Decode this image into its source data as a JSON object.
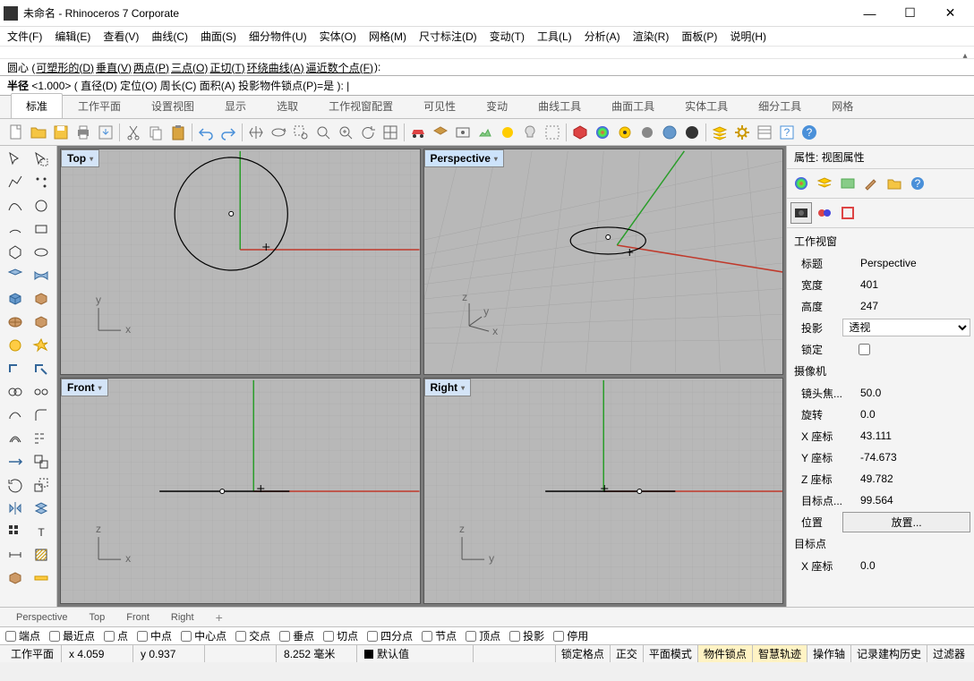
{
  "window": {
    "title": "未命名 - Rhinoceros 7 Corporate"
  },
  "menubar": [
    "文件(F)",
    "编辑(E)",
    "查看(V)",
    "曲线(C)",
    "曲面(S)",
    "细分物件(U)",
    "实体(O)",
    "网格(M)",
    "尺寸标注(D)",
    "变动(T)",
    "工具(L)",
    "分析(A)",
    "渲染(R)",
    "面板(P)",
    "说明(H)"
  ],
  "cmd": {
    "history_hint": "",
    "line1_prefix": "圆心 ( ",
    "line1_opts": [
      "可塑形的(D)",
      "垂直(V)",
      "两点(P)",
      "三点(O)",
      "正切(T)",
      "环绕曲线(A)",
      "逼近数个点(F)"
    ],
    "line2_label": "半径",
    "line2_val": "<1.000>",
    "line2_prefix": " ( ",
    "line2_opts": [
      "直径(D)",
      "定位(O)",
      "周长(C)",
      "面积(A)"
    ],
    "line2_kv": "投影物件锁点(P)=是",
    "suffix": " ):",
    "cursor": "|"
  },
  "tabs": [
    "标准",
    "工作平面",
    "设置视图",
    "显示",
    "选取",
    "工作视窗配置",
    "可见性",
    "变动",
    "曲线工具",
    "曲面工具",
    "实体工具",
    "细分工具",
    "网格"
  ],
  "active_tab": 0,
  "viewports": {
    "tl": {
      "label": "Top"
    },
    "tr": {
      "label": "Perspective"
    },
    "bl": {
      "label": "Front"
    },
    "br": {
      "label": "Right"
    }
  },
  "vptabs": [
    "Perspective",
    "Top",
    "Front",
    "Right"
  ],
  "properties": {
    "header": "属性: 视图属性",
    "sec_viewport": "工作视窗",
    "title_lbl": "标题",
    "title_val": "Perspective",
    "width_lbl": "宽度",
    "width_val": "401",
    "height_lbl": "高度",
    "height_val": "247",
    "proj_lbl": "投影",
    "proj_val": "透视",
    "lock_lbl": "锁定",
    "sec_camera": "摄像机",
    "lens_lbl": "镜头焦...",
    "lens_val": "50.0",
    "rot_lbl": "旋转",
    "rot_val": "0.0",
    "x_lbl": "X 座标",
    "x_val": "43.111",
    "y_lbl": "Y 座标",
    "y_val": "-74.673",
    "z_lbl": "Z 座标",
    "z_val": "49.782",
    "tgtdist_lbl": "目标点...",
    "tgtdist_val": "99.564",
    "pos_lbl": "位置",
    "pos_btn": "放置...",
    "sec_target": "目标点",
    "tx_lbl": "X 座标",
    "tx_val": "0.0"
  },
  "osnap": [
    "端点",
    "最近点",
    "点",
    "中点",
    "中心点",
    "交点",
    "垂点",
    "切点",
    "四分点",
    "节点",
    "顶点",
    "投影",
    "停用"
  ],
  "status": {
    "cplane": "工作平面",
    "x": "x 4.059",
    "y": "y 0.937",
    "z": "",
    "dist": "8.252 毫米",
    "layer": "默认值",
    "panes": [
      "锁定格点",
      "正交",
      "平面模式",
      "物件锁点",
      "智慧轨迹",
      "操作轴",
      "记录建构历史",
      "过滤器"
    ],
    "hl": [
      3,
      4
    ]
  }
}
